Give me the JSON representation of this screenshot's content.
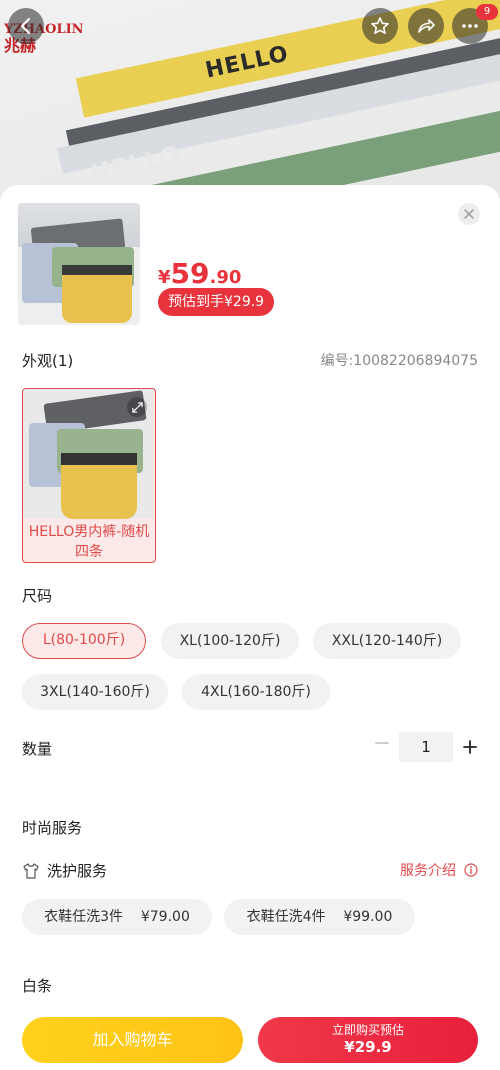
{
  "header": {
    "brand_en": "YZHAOLIN",
    "brand_cn": "兆赫",
    "hero_text_1": "HELLO",
    "hero_text_2": "HELLO",
    "cart_badge": "9"
  },
  "product": {
    "price_symbol": "¥",
    "price_integer": "59",
    "price_decimal": ".90",
    "estimated_price_label": "预估到手¥29.9",
    "product_code": "编号:10082206894075"
  },
  "appearance": {
    "label": "外观(1)",
    "variants": [
      {
        "label": "HELLO男内裤-随机四条"
      }
    ]
  },
  "size": {
    "label": "尺码",
    "options": [
      {
        "label": "L(80-100斤)",
        "selected": true
      },
      {
        "label": "XL(100-120斤)",
        "selected": false
      },
      {
        "label": "XXL(120-140斤)",
        "selected": false
      },
      {
        "label": "3XL(140-160斤)",
        "selected": false
      },
      {
        "label": "4XL(160-180斤)",
        "selected": false
      }
    ]
  },
  "quantity": {
    "label": "数量",
    "value": "1"
  },
  "services": {
    "section_label": "时尚服务",
    "item_label": "洗护服务",
    "intro_link": "服务介绍",
    "options": [
      {
        "name": "衣鞋任洗3件",
        "price": "¥79.00"
      },
      {
        "name": "衣鞋任洗4件",
        "price": "¥99.00"
      }
    ]
  },
  "baitiao": {
    "label": "白条"
  },
  "actions": {
    "add_to_cart": "加入购物车",
    "buy_now_line1": "立即购买预估",
    "buy_now_line2": "¥29.9"
  },
  "colors": {
    "accent_red": "#e8323c",
    "accent_yellow": "#ffc316",
    "chip_bg": "#f2f2f2"
  }
}
